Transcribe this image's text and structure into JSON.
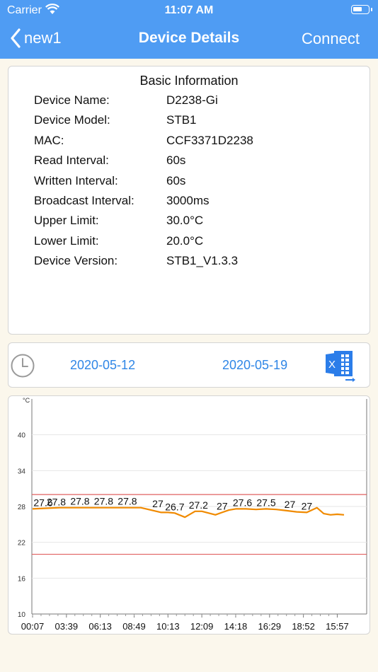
{
  "status_bar": {
    "carrier": "Carrier",
    "time": "11:07 AM"
  },
  "nav": {
    "back_label": "new1",
    "title": "Device Details",
    "right_label": "Connect"
  },
  "info": {
    "title": "Basic Information",
    "rows": [
      {
        "key": "Device Name:",
        "value": "D2238-Gi"
      },
      {
        "key": "Device Model:",
        "value": "STB1"
      },
      {
        "key": "MAC:",
        "value": "CCF3371D2238"
      },
      {
        "key": "Read Interval:",
        "value": "60s"
      },
      {
        "key": "Written Interval:",
        "value": "60s"
      },
      {
        "key": "Broadcast Interval:",
        "value": "3000ms"
      },
      {
        "key": "Upper Limit:",
        "value": "30.0°C"
      },
      {
        "key": "Lower Limit:",
        "value": "20.0°C"
      },
      {
        "key": "Device Version:",
        "value": "STB1_V1.3.3"
      }
    ]
  },
  "date_range": {
    "start": "2020-05-12",
    "end": "2020-05-19"
  },
  "icons": {
    "clock": "clock-icon",
    "export": "excel-export-icon",
    "back": "chevron-left-icon",
    "wifi": "wifi-icon",
    "battery": "battery-icon"
  },
  "colors": {
    "header": "#4f9cf3",
    "link": "#2f86e6",
    "series": "#f08a00",
    "limit_line": "#e06060"
  },
  "chart_data": {
    "type": "line",
    "y_unit": "°C",
    "ylim": [
      10,
      46
    ],
    "y_ticks": [
      10,
      16,
      22,
      28,
      34,
      40
    ],
    "x_tick_labels": [
      "00:07",
      "03:39",
      "06:13",
      "08:49",
      "10:13",
      "12:09",
      "14:18",
      "16:29",
      "18:52",
      "15:57"
    ],
    "upper_limit": 30,
    "lower_limit": 20,
    "grid": true,
    "series": [
      {
        "x": [
          0,
          0.4,
          0.8,
          1.2,
          1.6,
          2.0,
          2.4,
          2.8,
          3.2,
          3.5,
          3.8,
          4.0,
          4.2,
          4.5,
          4.8,
          5.0,
          5.2,
          5.4,
          5.6,
          5.8,
          6.0,
          6.3,
          6.6,
          6.9,
          7.2,
          7.5,
          7.8,
          8.1,
          8.4,
          8.6,
          8.8,
          9.0,
          9.2
        ],
        "values": [
          27.6,
          27.7,
          27.8,
          27.8,
          27.8,
          27.8,
          27.8,
          27.8,
          27.8,
          27.4,
          27.0,
          27.0,
          26.9,
          26.2,
          27.2,
          27.2,
          26.9,
          26.6,
          27.0,
          27.4,
          27.6,
          27.6,
          27.5,
          27.6,
          27.5,
          27.3,
          27.1,
          27.0,
          27.8,
          26.8,
          26.6,
          26.7,
          26.6
        ]
      }
    ],
    "data_labels": [
      {
        "x": 0.0,
        "text": "27.6"
      },
      {
        "x": 0.7,
        "text": "27.8"
      },
      {
        "x": 1.4,
        "text": "27.8"
      },
      {
        "x": 2.1,
        "text": "27.8"
      },
      {
        "x": 2.8,
        "text": "27.8"
      },
      {
        "x": 3.7,
        "text": "27"
      },
      {
        "x": 4.2,
        "text": "26.7"
      },
      {
        "x": 4.9,
        "text": "27.2"
      },
      {
        "x": 5.6,
        "text": "27"
      },
      {
        "x": 6.2,
        "text": "27.6"
      },
      {
        "x": 6.9,
        "text": "27.5"
      },
      {
        "x": 7.6,
        "text": "27"
      },
      {
        "x": 8.1,
        "text": "27"
      }
    ]
  }
}
